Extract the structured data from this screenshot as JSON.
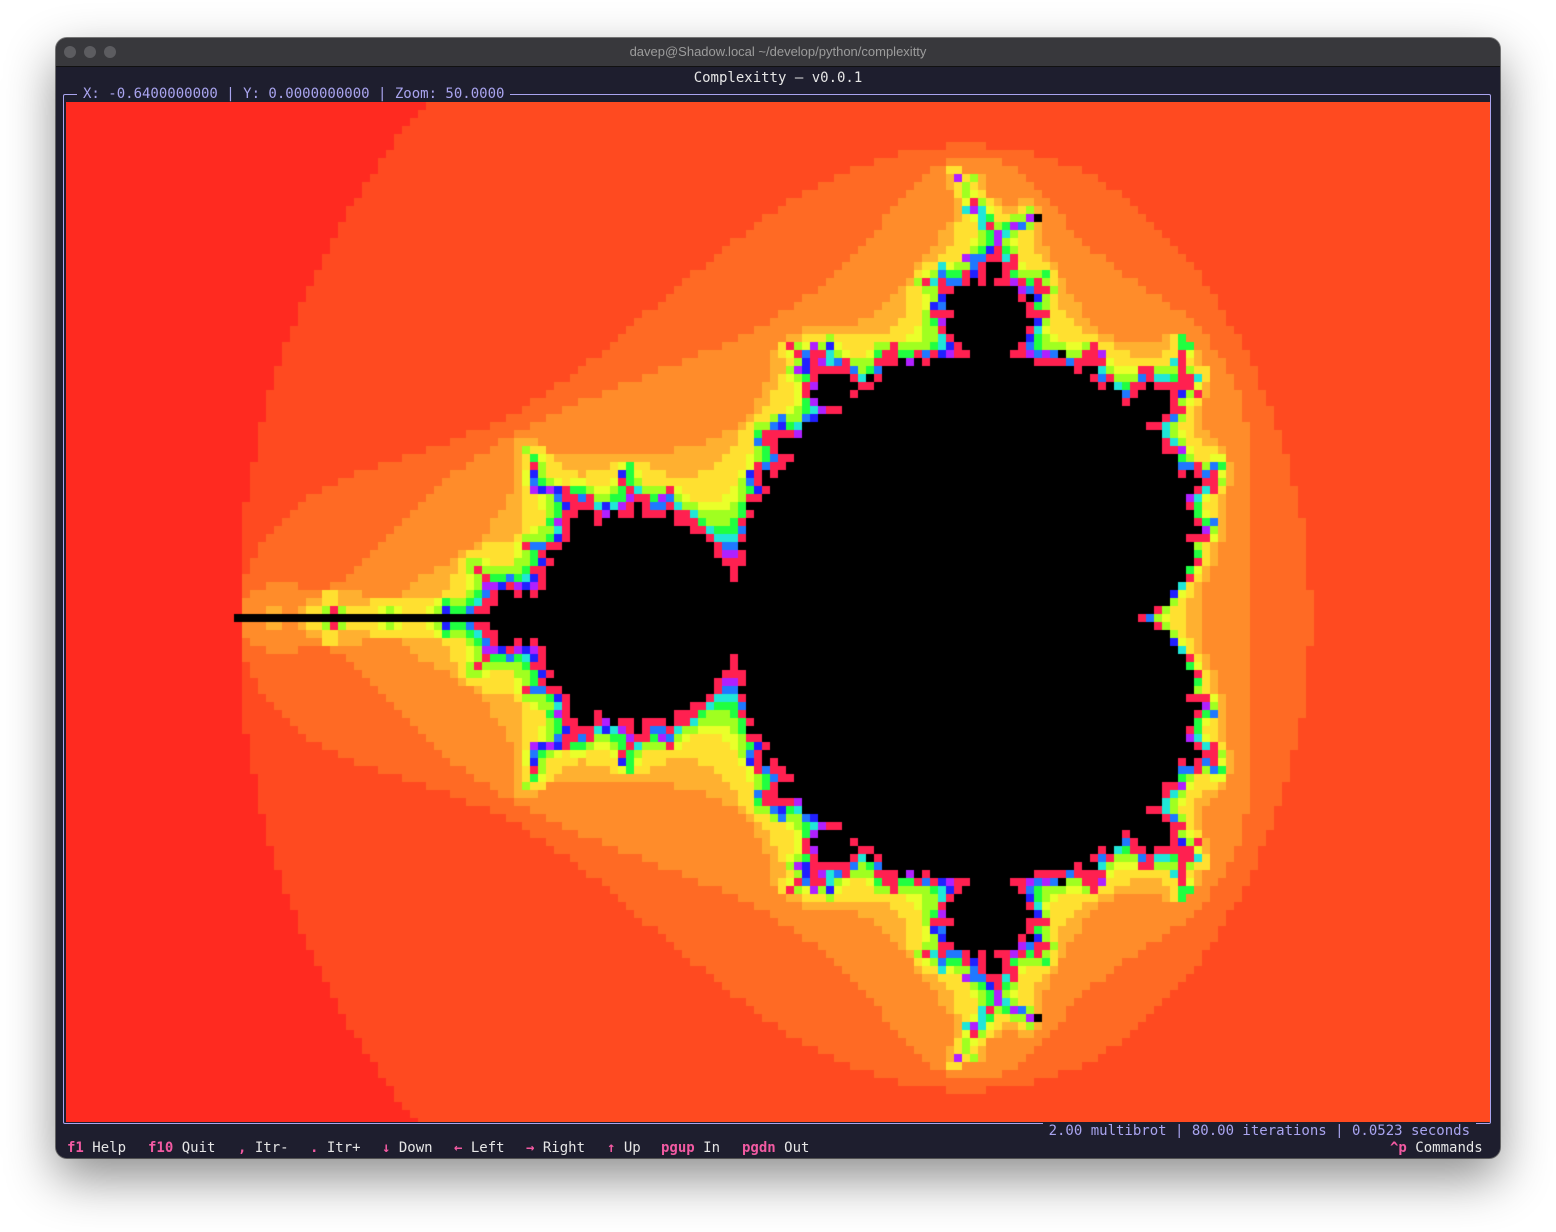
{
  "window": {
    "title": "davep@Shadow.local ~/develop/python/complexitty"
  },
  "app": {
    "title": "Complexitty — v0.0.1"
  },
  "coords": {
    "text": "X: -0.6400000000 | Y: 0.0000000000 | Zoom: 50.0000"
  },
  "status": {
    "text": "2.00 multibrot | 80.00 iterations | 0.0523 seconds"
  },
  "footer": {
    "items": [
      {
        "key": "f1",
        "label": "Help"
      },
      {
        "key": "f10",
        "label": "Quit"
      },
      {
        "key": ",",
        "label": "Itr-"
      },
      {
        "key": ".",
        "label": "Itr+"
      },
      {
        "key": "↓",
        "label": "Down"
      },
      {
        "key": "←",
        "label": "Left"
      },
      {
        "key": "→",
        "label": "Right"
      },
      {
        "key": "↑",
        "label": "Up"
      },
      {
        "key": "pgup",
        "label": "In"
      },
      {
        "key": "pgdn",
        "label": "Out"
      }
    ],
    "commands": {
      "key": "^p",
      "label": "Commands"
    }
  },
  "fractal": {
    "type": "multibrot",
    "power": 2,
    "max_iterations": 80,
    "center_x": -0.64,
    "center_y": 0.0,
    "zoom": 50,
    "inside_color": "#000000",
    "palette": [
      "#ff2a20",
      "#ff4a20",
      "#ff6a24",
      "#ff8c2a",
      "#ffb030",
      "#ffe030",
      "#eaff2a",
      "#a0ff20",
      "#20ff40",
      "#20e6d8",
      "#2078ff",
      "#2020ff",
      "#b020ff",
      "#ff2050"
    ]
  }
}
